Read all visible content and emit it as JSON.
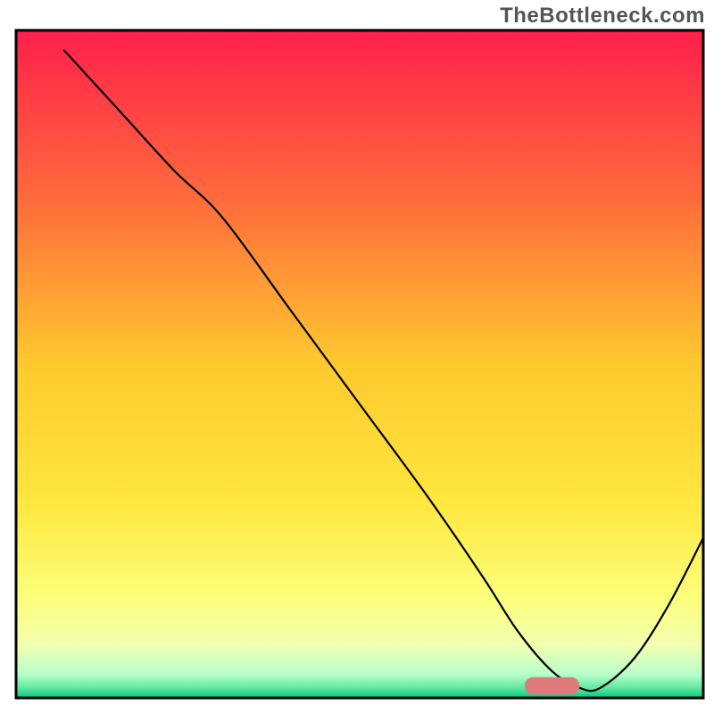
{
  "watermark": "TheBottleneck.com",
  "chart_data": {
    "type": "line",
    "title": "",
    "xlabel": "",
    "ylabel": "",
    "xlim": [
      0,
      100
    ],
    "ylim": [
      0,
      100
    ],
    "axes_visible": false,
    "grid": false,
    "annotations": [],
    "background_gradient": {
      "stops": [
        {
          "offset": 0.0,
          "color": "#ff1f4b"
        },
        {
          "offset": 0.25,
          "color": "#ff6a3c"
        },
        {
          "offset": 0.5,
          "color": "#ffc92e"
        },
        {
          "offset": 0.7,
          "color": "#ffe63d"
        },
        {
          "offset": 0.85,
          "color": "#fbff7a"
        },
        {
          "offset": 0.92,
          "color": "#f4ffb0"
        },
        {
          "offset": 0.965,
          "color": "#b7ffca"
        },
        {
          "offset": 0.985,
          "color": "#5fe8a0"
        },
        {
          "offset": 1.0,
          "color": "#00c97c"
        }
      ]
    },
    "series": [
      {
        "name": "bottleneck-curve",
        "color": "#000000",
        "stroke_width": 2.2,
        "x": [
          7,
          15,
          23,
          30,
          40,
          50,
          60,
          68,
          73,
          78,
          82,
          85,
          90,
          95,
          100
        ],
        "y": [
          97,
          88,
          79,
          72,
          58,
          44,
          30,
          18,
          10,
          4,
          1.5,
          1.5,
          6,
          14,
          24
        ]
      }
    ],
    "marker": {
      "name": "optimal-range-marker",
      "shape": "rounded-rect",
      "color": "#e07a7a",
      "x_start": 74,
      "x_end": 82,
      "y": 1.8,
      "height": 2.6
    },
    "frame": {
      "stroke": "#000000",
      "stroke_width": 3
    }
  }
}
